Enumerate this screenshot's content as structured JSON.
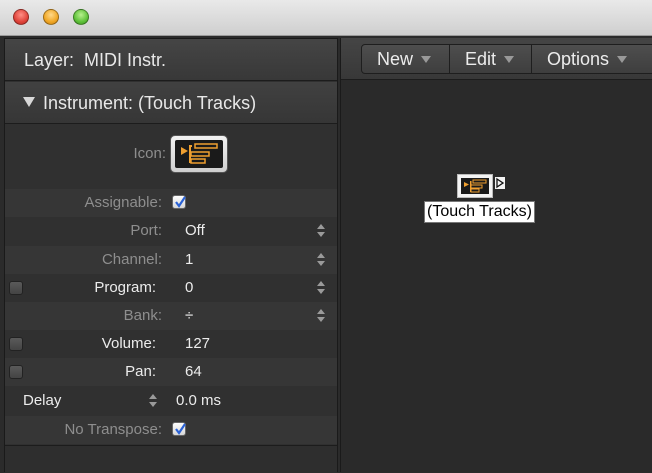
{
  "window": {
    "controls": [
      "close",
      "minimize",
      "zoom"
    ]
  },
  "inspector": {
    "layer_label": "Layer:",
    "layer_value": "MIDI Instr.",
    "instrument_header": "Instrument: (Touch Tracks)",
    "icon_label": "Icon:",
    "assignable_label": "Assignable:",
    "port_label": "Port:",
    "port_value": "Off",
    "channel_label": "Channel:",
    "channel_value": "1",
    "program_label": "Program:",
    "program_value": "0",
    "bank_label": "Bank:",
    "bank_value": "÷",
    "volume_label": "Volume:",
    "volume_value": "127",
    "pan_label": "Pan:",
    "pan_value": "64",
    "delay_label": "Delay",
    "delay_value": "0.0 ms",
    "no_transpose_label": "No Transpose:"
  },
  "toolbar": {
    "new_label": "New",
    "edit_label": "Edit",
    "options_label": "Options"
  },
  "canvas": {
    "object_label": "(Touch Tracks)"
  },
  "colors": {
    "accent_orange": "#f0a030",
    "checkbox_blue": "#2a62d6"
  }
}
